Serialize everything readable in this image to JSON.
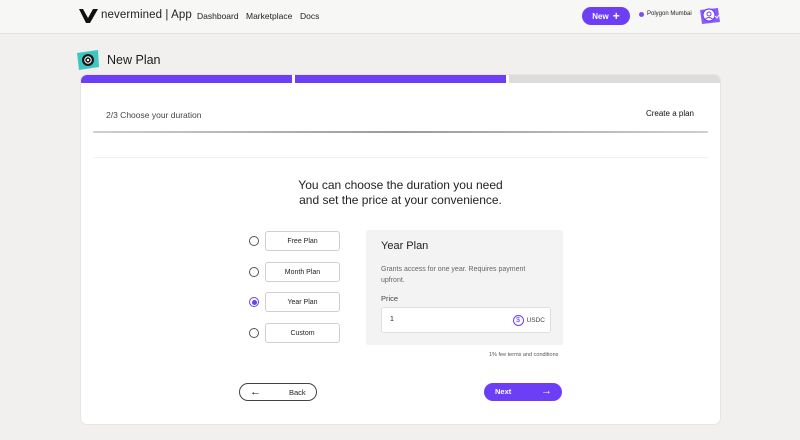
{
  "header": {
    "brand": "nevermined | App",
    "nav": [
      {
        "label": "Dashboard"
      },
      {
        "label": "Marketplace"
      },
      {
        "label": "Docs"
      }
    ],
    "new_button": "New",
    "network": "Polygon Mumbai"
  },
  "page": {
    "title": "New Plan"
  },
  "wizard": {
    "progress": {
      "completed_steps": 2,
      "total_steps": 3
    },
    "step_label": "2/3 Choose your duration",
    "create_link": "Create a plan",
    "heading_line1": "You can choose the duration you need",
    "heading_line2": "and set the price at your convenience.",
    "options": [
      {
        "label": "Free Plan",
        "selected": false
      },
      {
        "label": "Month Plan",
        "selected": false
      },
      {
        "label": "Year Plan",
        "selected": true
      },
      {
        "label": "Custom",
        "selected": false
      }
    ],
    "panel": {
      "title": "Year Plan",
      "description": "Grants access for one year. Requires payment upfront.",
      "price_label": "Price",
      "price_value": "1",
      "currency": "USDC"
    },
    "fee_note": "1% fee terms and conditions",
    "back_button": "Back",
    "next_button": "Next"
  },
  "colors": {
    "accent": "#6c3ef5",
    "background": "#f1f0ee",
    "progress_inactive": "#dcdcdc"
  },
  "icons": {
    "logo": "nevermined-logo",
    "plus": "plus-icon",
    "user": "user-avatar-icon",
    "plan": "plan-badge-icon",
    "usdc": "usdc-icon",
    "back": "arrow-left-icon",
    "next": "arrow-right-icon"
  }
}
